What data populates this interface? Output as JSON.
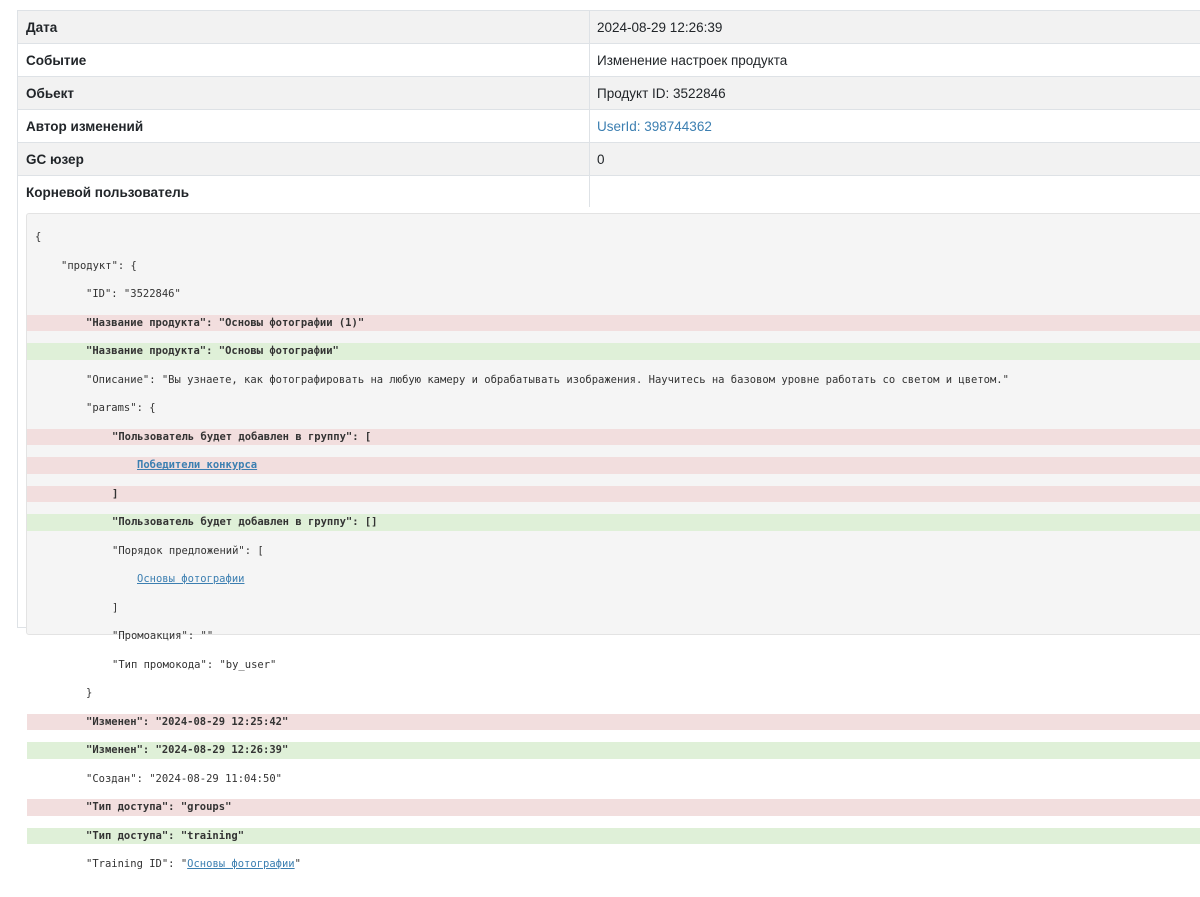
{
  "info_table": {
    "rows": [
      {
        "key": "Дата",
        "value": "2024-08-29 12:26:39"
      },
      {
        "key": "Событие",
        "value": "Изменение настроек продукта"
      },
      {
        "key": "Обьект",
        "value": "Продукт ID: 3522846"
      },
      {
        "key": "Автор изменений",
        "value": "UserId: 398744362"
      },
      {
        "key": "GC юзер",
        "value": "0"
      },
      {
        "key": "Корневой пользователь",
        "value": ""
      }
    ]
  },
  "diff": {
    "lines": [
      {
        "t": "{"
      },
      {
        "t": "\"продукт\": {"
      },
      {
        "t": "\"ID\": \"3522846\""
      },
      {
        "t": "\"Название продукта\": \"Основы фотографии (1)\""
      },
      {
        "t": "\"Название продукта\": \"Основы фотографии\""
      },
      {
        "t": "\"Описание\": \"Вы узнаете, как фотографировать на любую камеру и обрабатывать изображения. Научитесь на базовом уровне работать со светом и цветом.\""
      },
      {
        "t": "\"params\": {"
      },
      {
        "t": "\"Пользователь будет добавлен в группу\": ["
      },
      {
        "t": "Победители конкурса"
      },
      {
        "t": "]"
      },
      {
        "t": "\"Пользователь будет добавлен в группу\": []"
      },
      {
        "t": "\"Порядок предложений\": ["
      },
      {
        "t": "Основы фотографии"
      },
      {
        "t": "]"
      },
      {
        "t": "\"Промоакция\": \"\""
      },
      {
        "t": "\"Тип промокода\": \"by_user\""
      },
      {
        "t": "}"
      },
      {
        "t": "\"Изменен\": \"2024-08-29 12:25:42\""
      },
      {
        "t": "\"Изменен\": \"2024-08-29 12:26:39\""
      },
      {
        "t": "\"Создан\": \"2024-08-29 11:04:50\""
      },
      {
        "t": "\"Тип доступа\": \"groups\""
      },
      {
        "t": "\"Тип доступа\": \"training\""
      },
      {
        "p": "\"Training ID\": \"",
        "l": "Основы фотографии",
        "s": "\""
      }
    ]
  },
  "colors": {
    "removed_bg": "#f2dede",
    "added_bg": "#dff0d8",
    "link": "#3c7fb1"
  }
}
